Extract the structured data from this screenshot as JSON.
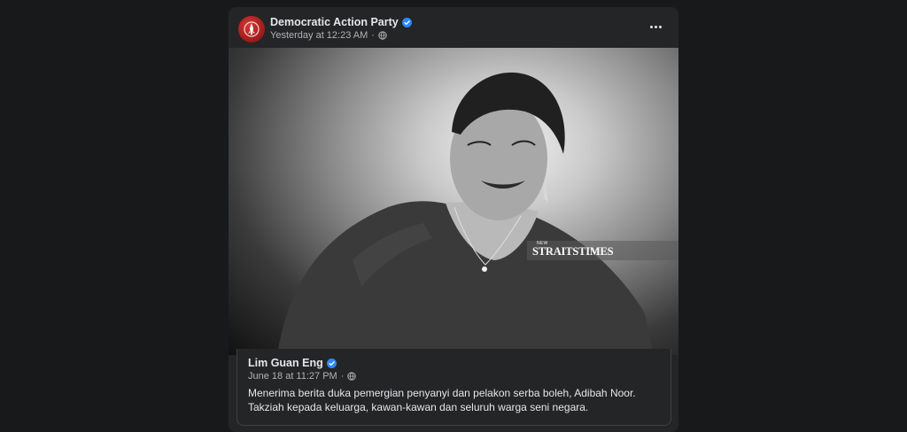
{
  "post": {
    "page_name": "Democratic Action Party",
    "timestamp": "Yesterday at 12:23 AM",
    "privacy_icon": "globe-icon",
    "verified_icon": "verified-badge-icon",
    "more_icon": "more-options-icon"
  },
  "photo": {
    "watermark_small": "NEW",
    "watermark_main": "STRAITSTIMES"
  },
  "shared_post": {
    "author": "Lim Guan Eng",
    "timestamp": "June 18 at 11:27 PM",
    "text": "Menerima berita duka pemergian penyanyi dan pelakon serba boleh, Adibah Noor. Takziah kepada keluarga, kawan-kawan dan seluruh warga seni negara."
  },
  "colors": {
    "background": "#18191a",
    "card": "#242526",
    "verified": "#2d88ff",
    "brand_red": "#c62828"
  }
}
